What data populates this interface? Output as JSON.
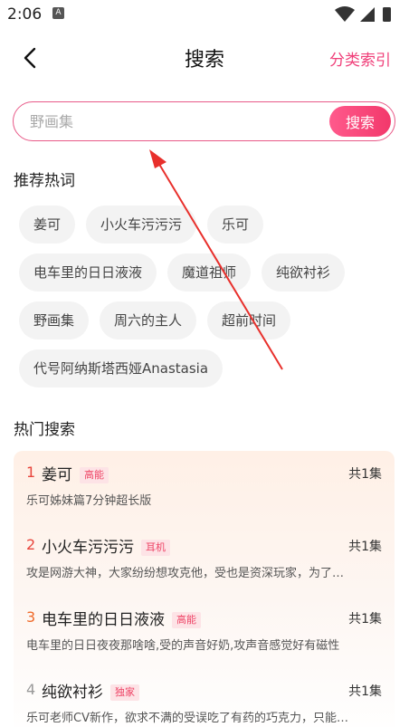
{
  "status_bar": {
    "time": "2:06",
    "a_badge": "A"
  },
  "header": {
    "title": "搜索",
    "category_link": "分类索引"
  },
  "search": {
    "value": "",
    "placeholder": "野画集",
    "button_label": "搜索"
  },
  "recommended": {
    "title": "推荐热词",
    "rows": [
      [
        "姜可",
        "小火车污污污",
        "乐可"
      ],
      [
        "电车里的日日液液",
        "魔道祖师",
        "纯欲衬衫"
      ],
      [
        "野画集",
        "周六的主人",
        "超前时间"
      ],
      [
        "代号阿纳斯塔西娅Anastasia"
      ]
    ]
  },
  "hot": {
    "title": "热门搜索",
    "items": [
      {
        "rank": "1",
        "title": "姜可",
        "badge": "高能",
        "episodes": "共1集",
        "desc": "乐可姊妹篇7分钟超长版",
        "rank_color": "#e8453c"
      },
      {
        "rank": "2",
        "title": "小火车污污污",
        "badge": "耳机",
        "episodes": "共1集",
        "desc": "攻是网游大神，大家纷纷想攻克他，受也是资深玩家，为了…",
        "rank_color": "#e8453c"
      },
      {
        "rank": "3",
        "title": "电车里的日日液液",
        "badge": "高能",
        "episodes": "共1集",
        "desc": "电车里的日日夜夜那啥啥,受的声音好奶,攻声音感觉好有磁性",
        "rank_color": "#ef6a2a"
      },
      {
        "rank": "4",
        "title": "纯欲衬衫",
        "badge": "独家",
        "episodes": "共1集",
        "desc": "乐可老师CV新作，欲求不满的受误吃了有药的巧克力，只能…",
        "rank_color": "#999999"
      }
    ]
  },
  "colors": {
    "accent": "#f0407a",
    "badge_text": "#ee4466",
    "badge_bg": "#fde3e6",
    "arrow": "#e8302c"
  }
}
